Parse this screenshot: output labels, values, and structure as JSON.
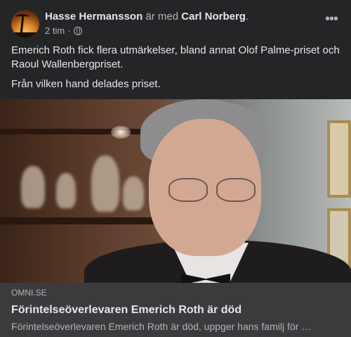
{
  "post": {
    "author": "Hasse Hermansson",
    "with_text": "är med",
    "tagged": "Carl Norberg",
    "period": ".",
    "time": "2 tim",
    "time_separator": "·",
    "privacy_icon": "globe-icon",
    "more_icon": "more-options-icon",
    "more_glyph": "•••",
    "paragraphs": [
      "Emerich Roth fick flera utmärkelser, bland annat Olof Palme-priset och Raoul Wallenbergpriset.",
      "Från vilken hand delades priset."
    ]
  },
  "link": {
    "domain": "OMNI.SE",
    "title": "Förintelseöverlevaren Emerich Roth är död",
    "description": "Förintelseöverlevaren Emerich Roth är död, uppger hans familj för …"
  }
}
